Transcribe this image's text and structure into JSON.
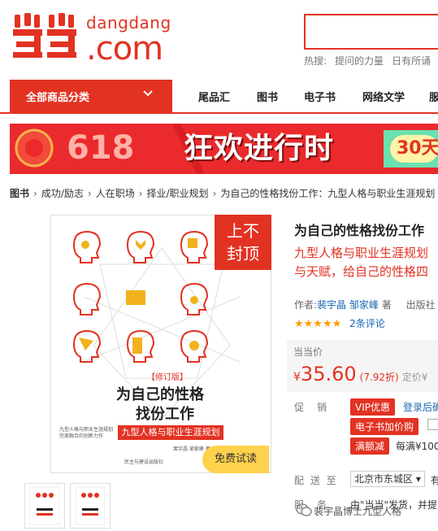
{
  "logo": {
    "cn_alt": "当当",
    "top": "dangdang",
    "bottom": ".com"
  },
  "search": {
    "value": "",
    "hot_label": "热搜:",
    "hot_items": [
      "提问的力量",
      "日有所诵"
    ]
  },
  "nav": {
    "category_label": "全部商品分类",
    "items": [
      "尾品汇",
      "图书",
      "电子书",
      "网络文学",
      "服"
    ]
  },
  "banner": {
    "left_text": "618",
    "main_text": "狂欢进行时",
    "right_text": "30天"
  },
  "breadcrumb": [
    "图书",
    "成功/励志",
    "人在职场",
    "择业/职业规划",
    "为自己的性格找份工作：九型人格与职业生涯规划"
  ],
  "cover": {
    "edition": "【修订版】",
    "title_line1": "为自己的性格",
    "title_line2": "找份工作",
    "subtitle": "九型人格与职业生涯规划",
    "blurb": [
      "九型人格与职业生涯规划",
      "完美融合的创新力作"
    ],
    "authors": "裴宇晶 邹家峰 著",
    "publisher": "民主与建设出版社",
    "tag_line1": "上不",
    "tag_line2": "封顶",
    "trial": "免费试读"
  },
  "product": {
    "title": "为自己的性格找份工作",
    "subtitle_line1": "九型人格与职业生涯规划",
    "subtitle_line2": "与天赋，给自己的性格四",
    "author_label": "作者:",
    "author1": "裴宇晶",
    "author2": "邹家峰",
    "author_suffix": "著",
    "publisher_label": "出版社",
    "stars": "★★★★★",
    "rating": 5,
    "reviews": "2条评论",
    "price_label": "当当价",
    "price_symbol": "¥",
    "price": "35.60",
    "discount": "(7.92折)",
    "original_label": "定价¥"
  },
  "promo": {
    "label": "促　销",
    "vip_badge": "VIP优惠",
    "vip_text": "登录后确",
    "ebook_badge": "电子书加价购",
    "full_badge": "满额减",
    "full_text": "每满¥100"
  },
  "delivery": {
    "label": "配 送 至",
    "address": "北京市东城区 ▾",
    "suffix": "有"
  },
  "service": {
    "label": "服　务",
    "text": "由\"当当\"发货，并提"
  },
  "watermark": "裴宇晶博士九型人格",
  "colors": {
    "brand": "#e23222",
    "link": "#1a66b3",
    "star": "#ff9d00"
  }
}
